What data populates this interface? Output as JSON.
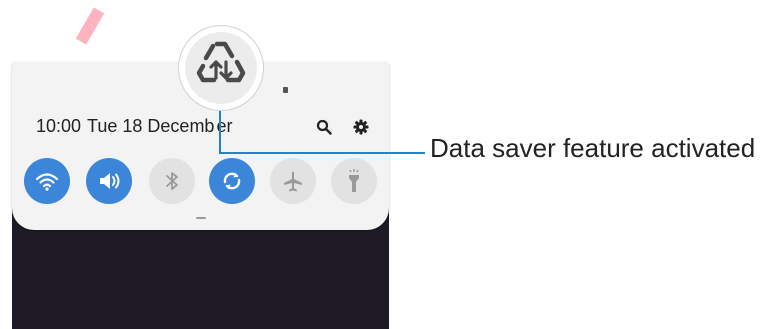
{
  "status_bar": {
    "time": "10:00",
    "date": "Tue 18 Decemb",
    "date_end": "er"
  },
  "callout": {
    "label": "Data saver feature activated"
  },
  "quick_settings": [
    {
      "icon": "wifi-icon",
      "state": "on"
    },
    {
      "icon": "sound-icon",
      "state": "on"
    },
    {
      "icon": "bluetooth-icon",
      "state": "off"
    },
    {
      "icon": "auto-rotate-icon",
      "state": "on"
    },
    {
      "icon": "airplane-mode-icon",
      "state": "off"
    },
    {
      "icon": "flashlight-icon",
      "state": "off"
    }
  ],
  "colors": {
    "accent": "#3b86d9",
    "callout_line": "#1c86c9"
  }
}
